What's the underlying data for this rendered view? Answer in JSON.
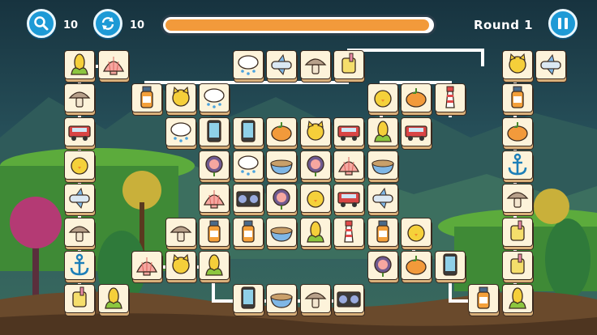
{
  "hud": {
    "hint_count": "10",
    "shuffle_count": "10",
    "round_label": "Round 1",
    "progress_percent": 99
  },
  "icons": {
    "hint": "magnifier-icon",
    "shuffle": "shuffle-icon",
    "pause": "pause-icon"
  },
  "colors": {
    "hud_button": "#1d9ad6",
    "progress_fill": "#f29a3b",
    "tile_face": "#fdf3da",
    "path_line": "#ffffff"
  },
  "board": {
    "rows": [
      [
        "",
        "",
        "corn",
        "shell",
        "",
        "",
        "",
        "cloud",
        "plane",
        "mushroom",
        "cup",
        "",
        "",
        "",
        "",
        "cat",
        "plane"
      ],
      [
        "",
        "",
        "mushroom",
        "",
        "bottle",
        "cat",
        "cloud",
        "",
        "",
        "",
        "",
        "chick",
        "pumpkin",
        "lighthouse",
        "",
        "bottle",
        ""
      ],
      [
        "",
        "",
        "jeep",
        "",
        "",
        "cloud",
        "phone",
        "phone",
        "pumpkin",
        "cat",
        "jeep",
        "corn",
        "jeep",
        "",
        "",
        "pumpkin",
        ""
      ],
      [
        "",
        "",
        "chick",
        "",
        "",
        "",
        "flower",
        "cloud",
        "bowl",
        "flower",
        "shell",
        "bowl",
        "",
        "",
        "",
        "anchor",
        ""
      ],
      [
        "",
        "",
        "plane",
        "",
        "",
        "",
        "shell",
        "radio",
        "flower",
        "chick",
        "jeep",
        "plane",
        "",
        "",
        "",
        "mushroom",
        ""
      ],
      [
        "",
        "",
        "mushroom",
        "",
        "",
        "mushroom",
        "bottle",
        "bottle",
        "bowl",
        "corn",
        "lighthouse",
        "bottle",
        "chick",
        "",
        "",
        "cup",
        ""
      ],
      [
        "",
        "",
        "anchor",
        "",
        "shell",
        "cat",
        "corn",
        "",
        "",
        "",
        "",
        "flower",
        "pumpkin",
        "phone",
        "",
        "cup",
        ""
      ],
      [
        "",
        "",
        "cup",
        "corn",
        "",
        "",
        "",
        "phone",
        "bowl",
        "mushroom",
        "radio",
        "",
        "",
        "",
        "bottle",
        "corn",
        ""
      ]
    ]
  }
}
